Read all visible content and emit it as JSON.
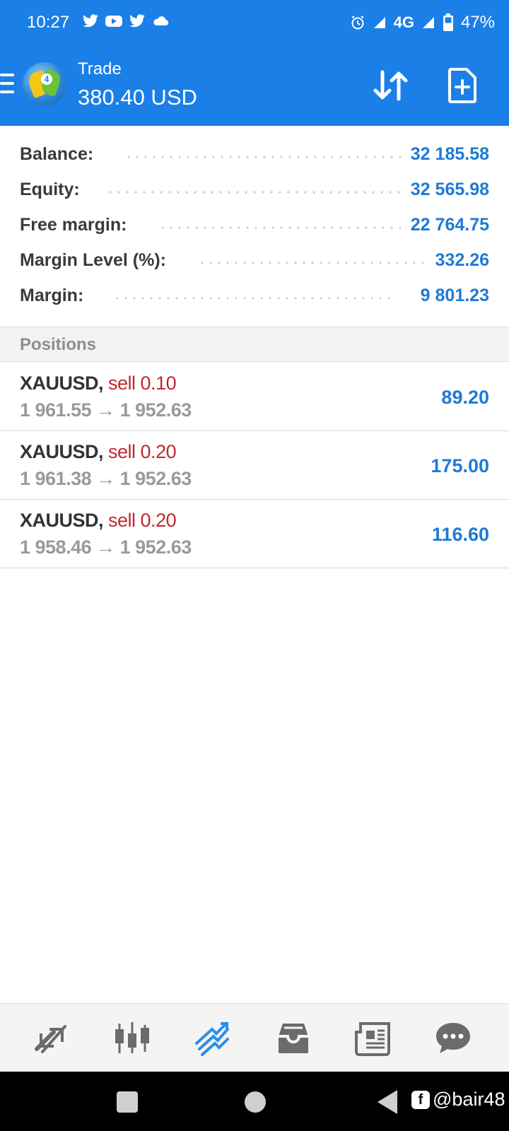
{
  "status_bar": {
    "time": "10:27",
    "left_icons": [
      "twitter-icon",
      "youtube-icon",
      "twitter-icon",
      "cloud-icon"
    ],
    "right_icons": [
      "alarm-icon",
      "signal-icon",
      "network-4g-icon",
      "signal-icon",
      "battery-icon"
    ],
    "network": "4G",
    "battery": "47%"
  },
  "app_bar": {
    "title": "Trade",
    "subtitle": "380.40 USD",
    "actions": [
      "sort-icon",
      "new-order-icon"
    ]
  },
  "account": {
    "rows": [
      {
        "label": "Balance:",
        "value": "32 185.58"
      },
      {
        "label": "Equity:",
        "value": "32 565.98"
      },
      {
        "label": "Free margin:",
        "value": "22 764.75"
      },
      {
        "label": "Margin Level (%):",
        "value": "332.26"
      },
      {
        "label": "Margin:",
        "value": "9 801.23"
      }
    ]
  },
  "positions": {
    "header": "Positions",
    "items": [
      {
        "symbol": "XAUUSD,",
        "side": "sell 0.10",
        "open": "1 961.55",
        "arrow": "→",
        "current": "1 952.63",
        "profit": "89.20"
      },
      {
        "symbol": "XAUUSD,",
        "side": "sell 0.20",
        "open": "1 961.38",
        "arrow": "→",
        "current": "1 952.63",
        "profit": "175.00"
      },
      {
        "symbol": "XAUUSD,",
        "side": "sell 0.20",
        "open": "1 958.46",
        "arrow": "→",
        "current": "1 952.63",
        "profit": "116.60"
      }
    ]
  },
  "bottom_nav": {
    "items": [
      "quotes-icon",
      "chart-icon",
      "trade-icon",
      "history-icon",
      "news-icon",
      "chat-icon"
    ],
    "active_index": 2,
    "active_color": "#2c8fe8",
    "inactive_color": "#6b6b6b"
  },
  "colors": {
    "brand": "#1b7fe8",
    "value": "#1e7ad6",
    "sell": "#c0282d"
  },
  "watermark": {
    "text": "@bair48",
    "icon": "facebook-icon"
  }
}
